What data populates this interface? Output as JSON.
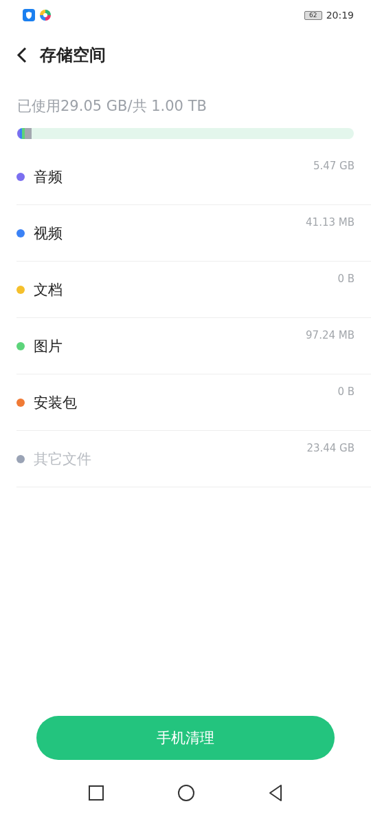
{
  "status_bar": {
    "battery": "62",
    "time": "20:19"
  },
  "header": {
    "title": "存储空间"
  },
  "summary": "已使用29.05 GB/共 1.00 TB",
  "usage_bar": {
    "segments": [
      {
        "color": "#7b6ff0",
        "level": 0.008
      },
      {
        "color": "#3b82f6",
        "level": 0.006
      },
      {
        "color": "#5cd47a",
        "level": 0.008
      },
      {
        "color": "#a3a8b0",
        "level": 0.02
      }
    ]
  },
  "categories": [
    {
      "name": "音频",
      "size": "5.47 GB",
      "color": "#7b6ff0",
      "disabled": false
    },
    {
      "name": "视频",
      "size": "41.13 MB",
      "color": "#3b82f6",
      "disabled": false
    },
    {
      "name": "文档",
      "size": "0 B",
      "color": "#f5c02c",
      "disabled": false
    },
    {
      "name": "图片",
      "size": "97.24 MB",
      "color": "#5cd47a",
      "disabled": false
    },
    {
      "name": "安装包",
      "size": "0 B",
      "color": "#f07a35",
      "disabled": false
    },
    {
      "name": "其它文件",
      "size": "23.44 GB",
      "color": "#9aa3b5",
      "disabled": true
    }
  ],
  "clean_button": "手机清理"
}
